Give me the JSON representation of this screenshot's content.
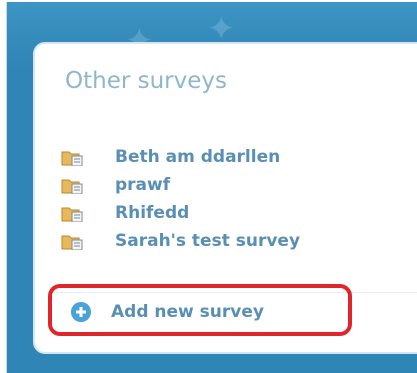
{
  "panel": {
    "title": "Other surveys"
  },
  "surveys": [
    {
      "label": "Beth am ddarllen",
      "icon": "folder-document-icon"
    },
    {
      "label": "prawf",
      "icon": "folder-document-icon"
    },
    {
      "label": "Rhifedd",
      "icon": "folder-document-icon"
    },
    {
      "label": "Sarah's test survey",
      "icon": "folder-document-icon"
    }
  ],
  "add_survey": {
    "label": "Add new survey",
    "icon": "plus-circle-icon"
  },
  "colors": {
    "page_background": "#2f86b6",
    "panel_background": "#ffffff",
    "title": "#8fb7cc",
    "link": "#5a8fb5",
    "highlight": "#e0262a",
    "plus_icon": "#4aa3d8"
  }
}
